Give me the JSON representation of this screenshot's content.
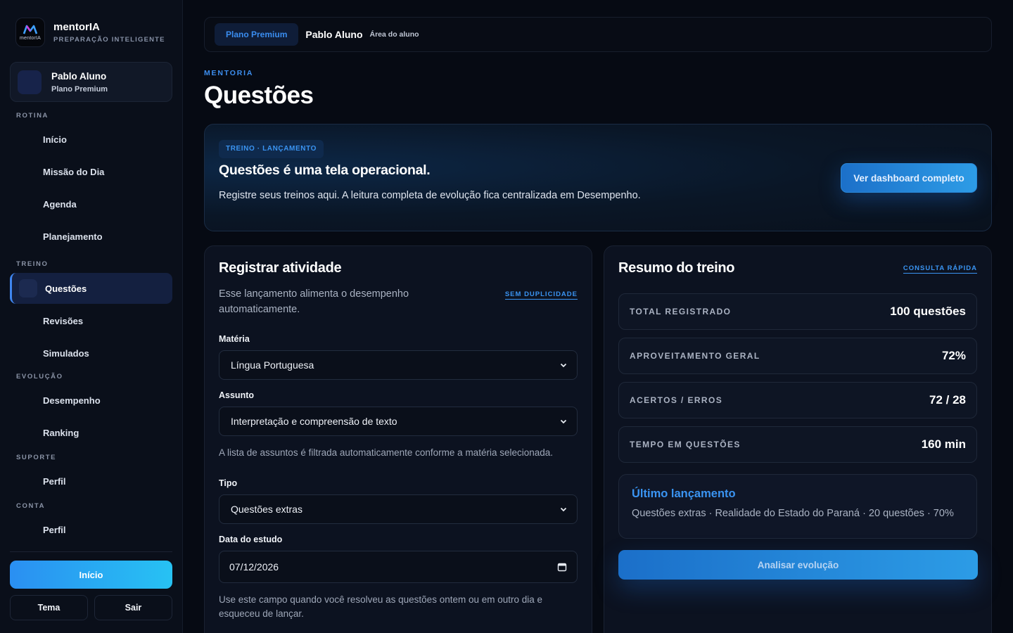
{
  "brand": {
    "name": "mentorIA",
    "tagline": "PREPARAÇÃO INTELIGENTE",
    "logo_text": "mentorIA"
  },
  "user": {
    "name": "Pablo Aluno",
    "plan": "Plano Premium"
  },
  "nav": {
    "sections": [
      {
        "title": "ROTINA",
        "items": [
          "Início",
          "Missão do Dia",
          "Agenda",
          "Planejamento"
        ]
      },
      {
        "title": "TREINO",
        "items": [
          "Questões",
          "Revisões",
          "Simulados"
        ]
      },
      {
        "title": "EVOLUÇÃO",
        "items": [
          "Desempenho",
          "Ranking"
        ]
      },
      {
        "title": "SUPORTE",
        "items": [
          "Perfil"
        ]
      },
      {
        "title": "CONTA",
        "items": [
          "Perfil"
        ]
      }
    ],
    "active": "Questões"
  },
  "sidebar_actions": {
    "home": "Início",
    "theme": "Tema",
    "logout": "Sair"
  },
  "topbar": {
    "plan": "Plano Premium",
    "user": "Pablo Aluno",
    "area": "Área do aluno"
  },
  "page": {
    "eyebrow": "MENTORIA",
    "title": "Questões"
  },
  "hero": {
    "tag": "TREINO · LANÇAMENTO",
    "title": "Questões é uma tela operacional.",
    "text": "Registre seus treinos aqui. A leitura completa de evolução fica centralizada em Desempenho.",
    "button": "Ver dashboard completo"
  },
  "register": {
    "title": "Registrar atividade",
    "subtitle": "Esse lançamento alimenta o desempenho automaticamente.",
    "badge": "SEM DUPLICIDADE",
    "subject_label": "Matéria",
    "subject_value": "Língua Portuguesa",
    "topic_label": "Assunto",
    "topic_value": "Interpretação e compreensão de texto",
    "topic_helper": "A lista de assuntos é filtrada automaticamente conforme a matéria selecionada.",
    "type_label": "Tipo",
    "type_value": "Questões extras",
    "date_label": "Data do estudo",
    "date_value": "07/12/2026",
    "date_helper": "Use este campo quando você resolveu as questões ontem ou em outro dia e esqueceu de lançar."
  },
  "summary": {
    "title": "Resumo do treino",
    "badge": "CONSULTA RÁPIDA",
    "stats": [
      {
        "label": "TOTAL REGISTRADO",
        "value": "100 questões"
      },
      {
        "label": "APROVEITAMENTO GERAL",
        "value": "72%"
      },
      {
        "label": "ACERTOS / ERROS",
        "value": "72 / 28"
      },
      {
        "label": "TEMPO EM QUESTÕES",
        "value": "160 min"
      }
    ],
    "last_title": "Último lançamento",
    "last_text": "Questões extras · Realidade do Estado do Paraná · 20 questões · 70%",
    "analyze_button": "Analisar evolução"
  },
  "colors": {
    "accent": "#3a94f2",
    "background": "#060a13",
    "panel": "#0c1220"
  }
}
